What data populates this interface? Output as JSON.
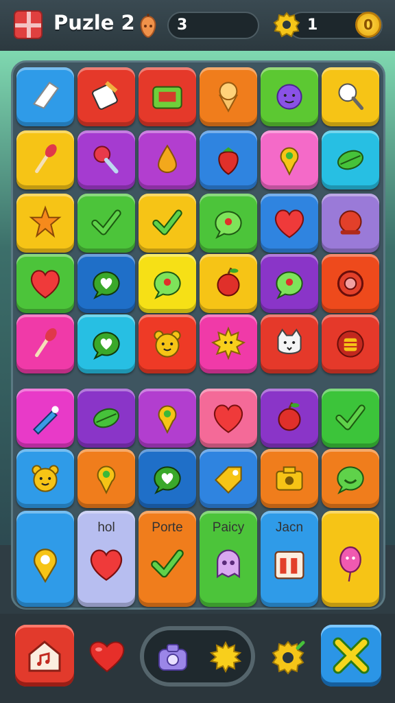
{
  "header": {
    "title": "Puzle 2",
    "moves": "3",
    "score": "1",
    "coin_symbol": "0"
  },
  "board": {
    "rows": [
      [
        {
          "color": "#2f9be8",
          "icon": "eraser-icon"
        },
        {
          "color": "#e5392a",
          "icon": "crayon-box-icon"
        },
        {
          "color": "#e5392a",
          "icon": "radio-icon"
        },
        {
          "color": "#f07d1c",
          "icon": "ice-cream-icon"
        },
        {
          "color": "#5cc832",
          "icon": "grape-face-icon"
        },
        {
          "color": "#f6c416",
          "icon": "magnifier-face-icon"
        }
      ],
      [
        {
          "color": "#f6c416",
          "icon": "brush-icon"
        },
        {
          "color": "#a53bd0",
          "icon": "lollipop-icon"
        },
        {
          "color": "#b23ecf",
          "icon": "drop-icon"
        },
        {
          "color": "#2f84e0",
          "icon": "strawberry-icon"
        },
        {
          "color": "#f46ac8",
          "icon": "pin-icon"
        },
        {
          "color": "#27bfe3",
          "icon": "leaf-icon"
        }
      ],
      [
        {
          "color": "#f6c416",
          "icon": "puzzle-star-icon"
        },
        {
          "color": "#4cc43a",
          "icon": "check-icon"
        },
        {
          "color": "#f6c416",
          "icon": "check-icon"
        },
        {
          "color": "#4cc43a",
          "icon": "chat-bubble-icon"
        },
        {
          "color": "#2f84e0",
          "icon": "heart-icon"
        },
        {
          "color": "#9a7ad8",
          "icon": "bell-icon"
        }
      ],
      [
        {
          "color": "#4cc43a",
          "icon": "heart-icon"
        },
        {
          "color": "#1f6fc8",
          "icon": "chat-heart-icon"
        },
        {
          "color": "#f6e016",
          "icon": "chat-bubble-icon"
        },
        {
          "color": "#f6c416",
          "icon": "apple-icon"
        },
        {
          "color": "#8a35c8",
          "icon": "chat-bubble-icon"
        },
        {
          "color": "#ee4a1c",
          "icon": "ring-icon"
        }
      ],
      [
        {
          "color": "#f03aa8",
          "icon": "brush-icon"
        },
        {
          "color": "#27bfe3",
          "icon": "chat-heart-icon"
        },
        {
          "color": "#ee3a26",
          "icon": "bear-face-icon"
        },
        {
          "color": "#f03aa8",
          "icon": "sun-face-icon"
        },
        {
          "color": "#e5392a",
          "icon": "cat-face-icon"
        },
        {
          "color": "#e5392a",
          "icon": "jar-icon"
        }
      ],
      [
        {
          "color": "#e83ac8",
          "icon": "crayon-icon"
        },
        {
          "color": "#8a35c8",
          "icon": "leaf-icon"
        },
        {
          "color": "#b23ecf",
          "icon": "pin-icon"
        },
        {
          "color": "#f46a98",
          "icon": "heart-icon"
        },
        {
          "color": "#8a35c8",
          "icon": "apple-icon"
        },
        {
          "color": "#3cc43a",
          "icon": "check-icon"
        }
      ],
      [
        {
          "color": "#2f9be8",
          "icon": "bear-face-icon"
        },
        {
          "color": "#f07d1c",
          "icon": "pin-icon"
        },
        {
          "color": "#1f6fc8",
          "icon": "chat-heart-icon"
        },
        {
          "color": "#2f84e0",
          "icon": "tag-icon"
        },
        {
          "color": "#f07d1c",
          "icon": "camera-icon"
        },
        {
          "color": "#f07d1c",
          "icon": "chat-smile-icon"
        }
      ]
    ],
    "bottom_row": [
      {
        "color": "#2f9be8",
        "icon": "location-icon",
        "label": ""
      },
      {
        "color": "#b7bef0",
        "icon": "heart-icon",
        "label": "hol"
      },
      {
        "color": "#f07d1c",
        "icon": "check-icon",
        "label": "Porte"
      },
      {
        "color": "#4cc43a",
        "icon": "ghost-icon",
        "label": "Paicy"
      },
      {
        "color": "#2f9be8",
        "icon": "box-icon",
        "label": "Jacn"
      },
      {
        "color": "#f6c416",
        "icon": "balloon-icon",
        "label": ""
      }
    ]
  },
  "footer": {
    "home_icon": "home-icon",
    "heart_icon": "heart-icon",
    "center_icons": [
      "camera-icon",
      "sun-icon"
    ],
    "gear_icon": "gear-icon",
    "close_icon": "close-icon"
  }
}
